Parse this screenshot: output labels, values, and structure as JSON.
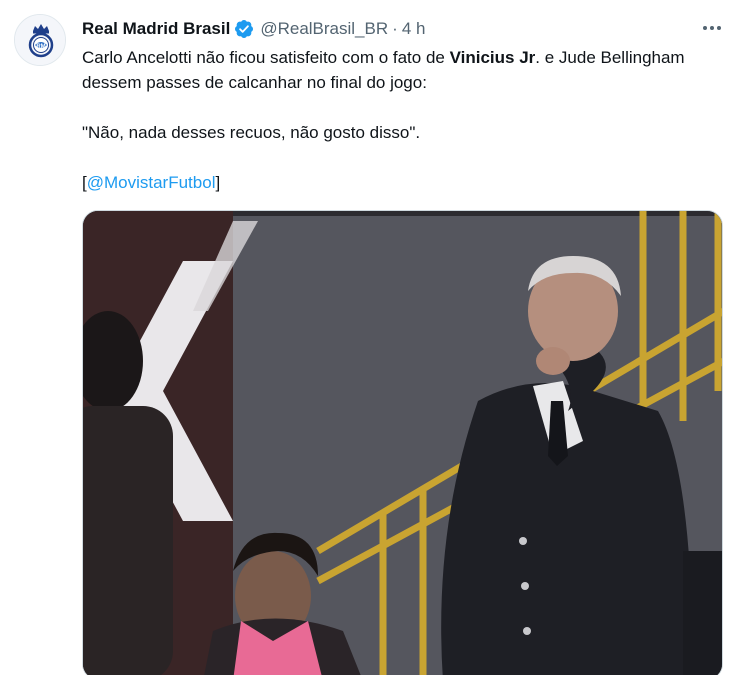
{
  "author": {
    "display_name": "Real Madrid Brasil",
    "handle": "@RealBrasil_BR",
    "separator": "·",
    "timestamp": "4 h",
    "verified": true,
    "avatar_icon": "club-crest-icon"
  },
  "tweet": {
    "line1_before": "Carlo Ancelotti não ficou satisfeito com o fato de ",
    "line1_bold": "Vinicius Jr",
    "line1_after": ". e Jude Bellingham dessem passes de calcanhar no final do jogo:",
    "quote": "\"Não, nada desses recuos, não gosto disso\".",
    "source_open": "[",
    "source_mention": "@MovistarFutbol",
    "source_close": "]"
  },
  "colors": {
    "link": "#1d9bf0",
    "verified": "#1d9bf0",
    "secondary_text": "#536471",
    "primary_text": "#0f1419"
  },
  "media": {
    "type": "video-still",
    "icon": "video-thumbnail"
  }
}
